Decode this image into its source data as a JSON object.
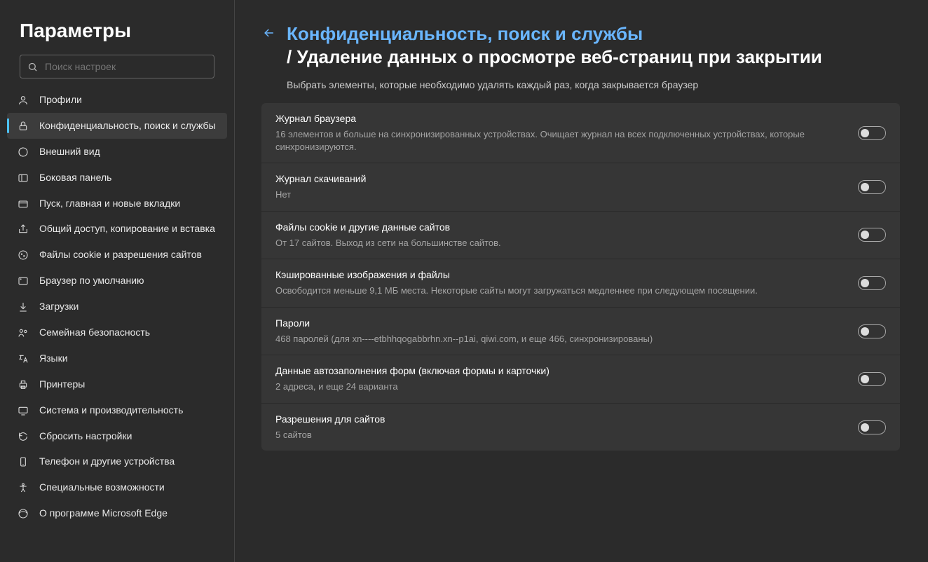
{
  "sidebar": {
    "title": "Параметры",
    "search_placeholder": "Поиск настроек",
    "items": [
      {
        "label": "Профили"
      },
      {
        "label": "Конфиденциальность, поиск и службы"
      },
      {
        "label": "Внешний вид"
      },
      {
        "label": "Боковая панель"
      },
      {
        "label": "Пуск, главная и новые вкладки"
      },
      {
        "label": "Общий доступ, копирование и вставка"
      },
      {
        "label": "Файлы cookie и разрешения сайтов"
      },
      {
        "label": "Браузер по умолчанию"
      },
      {
        "label": "Загрузки"
      },
      {
        "label": "Семейная безопасность"
      },
      {
        "label": "Языки"
      },
      {
        "label": "Принтеры"
      },
      {
        "label": "Система и производительность"
      },
      {
        "label": "Сбросить настройки"
      },
      {
        "label": "Телефон и другие устройства"
      },
      {
        "label": "Специальные возможности"
      },
      {
        "label": "О программе Microsoft Edge"
      }
    ]
  },
  "breadcrumb": {
    "link": "Конфиденциальность, поиск и службы",
    "sep": "/",
    "current": "Удаление данных о просмотре веб-страниц при закрытии"
  },
  "description": "Выбрать элементы, которые необходимо удалять каждый раз, когда закрывается браузер",
  "items": [
    {
      "title": "Журнал браузера",
      "sub": "16 элементов и больше на синхронизированных устройствах. Очищает журнал на всех подключенных устройствах, которые синхронизируются."
    },
    {
      "title": "Журнал скачиваний",
      "sub": "Нет"
    },
    {
      "title": "Файлы cookie и другие данные сайтов",
      "sub": "От 17 сайтов. Выход из сети на большинстве сайтов."
    },
    {
      "title": "Кэшированные изображения и файлы",
      "sub": "Освободится меньше 9,1 МБ места. Некоторые сайты могут загружаться медленнее при следующем посещении."
    },
    {
      "title": "Пароли",
      "sub": "468 паролей (для xn----etbhhqogabbrhn.xn--p1ai, qiwi.com, и еще 466, синхронизированы)"
    },
    {
      "title": "Данные автозаполнения форм (включая формы и карточки)",
      "sub": "2 адреса, и еще 24 варианта"
    },
    {
      "title": "Разрешения для сайтов",
      "sub": "5 сайтов"
    }
  ]
}
